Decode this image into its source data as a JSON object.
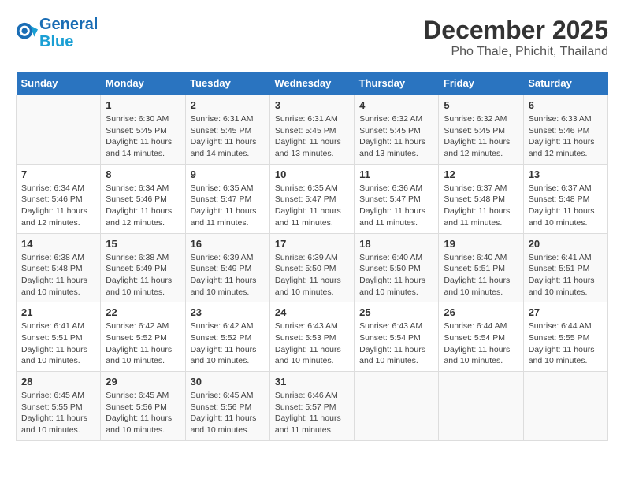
{
  "header": {
    "logo_line1": "General",
    "logo_line2": "Blue",
    "title": "December 2025",
    "subtitle": "Pho Thale, Phichit, Thailand"
  },
  "calendar": {
    "weekdays": [
      "Sunday",
      "Monday",
      "Tuesday",
      "Wednesday",
      "Thursday",
      "Friday",
      "Saturday"
    ],
    "weeks": [
      [
        {
          "day": null,
          "info": null
        },
        {
          "day": "1",
          "info": "Sunrise: 6:30 AM\nSunset: 5:45 PM\nDaylight: 11 hours\nand 14 minutes."
        },
        {
          "day": "2",
          "info": "Sunrise: 6:31 AM\nSunset: 5:45 PM\nDaylight: 11 hours\nand 14 minutes."
        },
        {
          "day": "3",
          "info": "Sunrise: 6:31 AM\nSunset: 5:45 PM\nDaylight: 11 hours\nand 13 minutes."
        },
        {
          "day": "4",
          "info": "Sunrise: 6:32 AM\nSunset: 5:45 PM\nDaylight: 11 hours\nand 13 minutes."
        },
        {
          "day": "5",
          "info": "Sunrise: 6:32 AM\nSunset: 5:45 PM\nDaylight: 11 hours\nand 12 minutes."
        },
        {
          "day": "6",
          "info": "Sunrise: 6:33 AM\nSunset: 5:46 PM\nDaylight: 11 hours\nand 12 minutes."
        }
      ],
      [
        {
          "day": "7",
          "info": "Sunrise: 6:34 AM\nSunset: 5:46 PM\nDaylight: 11 hours\nand 12 minutes."
        },
        {
          "day": "8",
          "info": "Sunrise: 6:34 AM\nSunset: 5:46 PM\nDaylight: 11 hours\nand 12 minutes."
        },
        {
          "day": "9",
          "info": "Sunrise: 6:35 AM\nSunset: 5:47 PM\nDaylight: 11 hours\nand 11 minutes."
        },
        {
          "day": "10",
          "info": "Sunrise: 6:35 AM\nSunset: 5:47 PM\nDaylight: 11 hours\nand 11 minutes."
        },
        {
          "day": "11",
          "info": "Sunrise: 6:36 AM\nSunset: 5:47 PM\nDaylight: 11 hours\nand 11 minutes."
        },
        {
          "day": "12",
          "info": "Sunrise: 6:37 AM\nSunset: 5:48 PM\nDaylight: 11 hours\nand 11 minutes."
        },
        {
          "day": "13",
          "info": "Sunrise: 6:37 AM\nSunset: 5:48 PM\nDaylight: 11 hours\nand 10 minutes."
        }
      ],
      [
        {
          "day": "14",
          "info": "Sunrise: 6:38 AM\nSunset: 5:48 PM\nDaylight: 11 hours\nand 10 minutes."
        },
        {
          "day": "15",
          "info": "Sunrise: 6:38 AM\nSunset: 5:49 PM\nDaylight: 11 hours\nand 10 minutes."
        },
        {
          "day": "16",
          "info": "Sunrise: 6:39 AM\nSunset: 5:49 PM\nDaylight: 11 hours\nand 10 minutes."
        },
        {
          "day": "17",
          "info": "Sunrise: 6:39 AM\nSunset: 5:50 PM\nDaylight: 11 hours\nand 10 minutes."
        },
        {
          "day": "18",
          "info": "Sunrise: 6:40 AM\nSunset: 5:50 PM\nDaylight: 11 hours\nand 10 minutes."
        },
        {
          "day": "19",
          "info": "Sunrise: 6:40 AM\nSunset: 5:51 PM\nDaylight: 11 hours\nand 10 minutes."
        },
        {
          "day": "20",
          "info": "Sunrise: 6:41 AM\nSunset: 5:51 PM\nDaylight: 11 hours\nand 10 minutes."
        }
      ],
      [
        {
          "day": "21",
          "info": "Sunrise: 6:41 AM\nSunset: 5:51 PM\nDaylight: 11 hours\nand 10 minutes."
        },
        {
          "day": "22",
          "info": "Sunrise: 6:42 AM\nSunset: 5:52 PM\nDaylight: 11 hours\nand 10 minutes."
        },
        {
          "day": "23",
          "info": "Sunrise: 6:42 AM\nSunset: 5:52 PM\nDaylight: 11 hours\nand 10 minutes."
        },
        {
          "day": "24",
          "info": "Sunrise: 6:43 AM\nSunset: 5:53 PM\nDaylight: 11 hours\nand 10 minutes."
        },
        {
          "day": "25",
          "info": "Sunrise: 6:43 AM\nSunset: 5:54 PM\nDaylight: 11 hours\nand 10 minutes."
        },
        {
          "day": "26",
          "info": "Sunrise: 6:44 AM\nSunset: 5:54 PM\nDaylight: 11 hours\nand 10 minutes."
        },
        {
          "day": "27",
          "info": "Sunrise: 6:44 AM\nSunset: 5:55 PM\nDaylight: 11 hours\nand 10 minutes."
        }
      ],
      [
        {
          "day": "28",
          "info": "Sunrise: 6:45 AM\nSunset: 5:55 PM\nDaylight: 11 hours\nand 10 minutes."
        },
        {
          "day": "29",
          "info": "Sunrise: 6:45 AM\nSunset: 5:56 PM\nDaylight: 11 hours\nand 10 minutes."
        },
        {
          "day": "30",
          "info": "Sunrise: 6:45 AM\nSunset: 5:56 PM\nDaylight: 11 hours\nand 10 minutes."
        },
        {
          "day": "31",
          "info": "Sunrise: 6:46 AM\nSunset: 5:57 PM\nDaylight: 11 hours\nand 11 minutes."
        },
        {
          "day": null,
          "info": null
        },
        {
          "day": null,
          "info": null
        },
        {
          "day": null,
          "info": null
        }
      ]
    ]
  }
}
